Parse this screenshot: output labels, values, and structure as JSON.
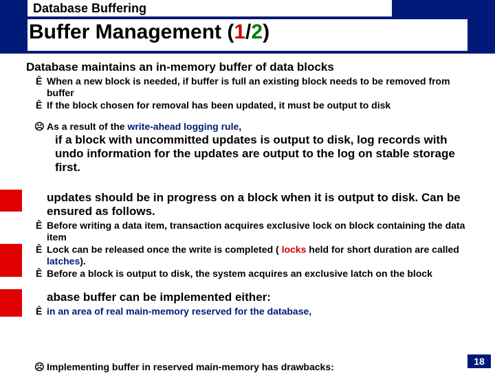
{
  "header": {
    "section": "Database Buffering",
    "title_pre": "Buffer Management (",
    "title_p1": "1",
    "title_slash": "/",
    "title_p2": "2",
    "title_post": ")"
  },
  "body": {
    "line1": "Database maintains an in-memory buffer of data blocks",
    "sub1a": "When a new block is needed, if buffer is full an existing block needs to be removed from buffer",
    "sub1b": "If the block chosen for removal has been updated, it must be output to disk",
    "sub1c_pre": "As a result of the ",
    "sub1c_hl": "write-ahead logging rule",
    "sub1c_post": ",",
    "emph": "if a block with uncommitted updates is output to disk, log records with undo information for the updates are output to the log on stable storage first.",
    "line2": "updates should be in progress on a block when it is output to disk.  Can be ensured as follows.",
    "sub2a": "Before writing a data item, transaction acquires exclusive lock on block containing the data item",
    "sub2b_pre": "Lock can be released once the write is completed ( ",
    "sub2b_look": "locks",
    "sub2b_mid": " held for short duration are called ",
    "sub2b_latch": "latches",
    "sub2b_post": ").",
    "sub2c": "Before a block is output to disk, the system acquires an exclusive latch on the block",
    "line3": "abase buffer can be implemented either:",
    "sub3a": "in an area of real main-memory reserved for the database,",
    "cutoff": "Implementing buffer in reserved main-memory has drawbacks:"
  },
  "glyphs": {
    "arrow": "Ê",
    "smile": "☺",
    "sad": "☹"
  },
  "page": "18"
}
